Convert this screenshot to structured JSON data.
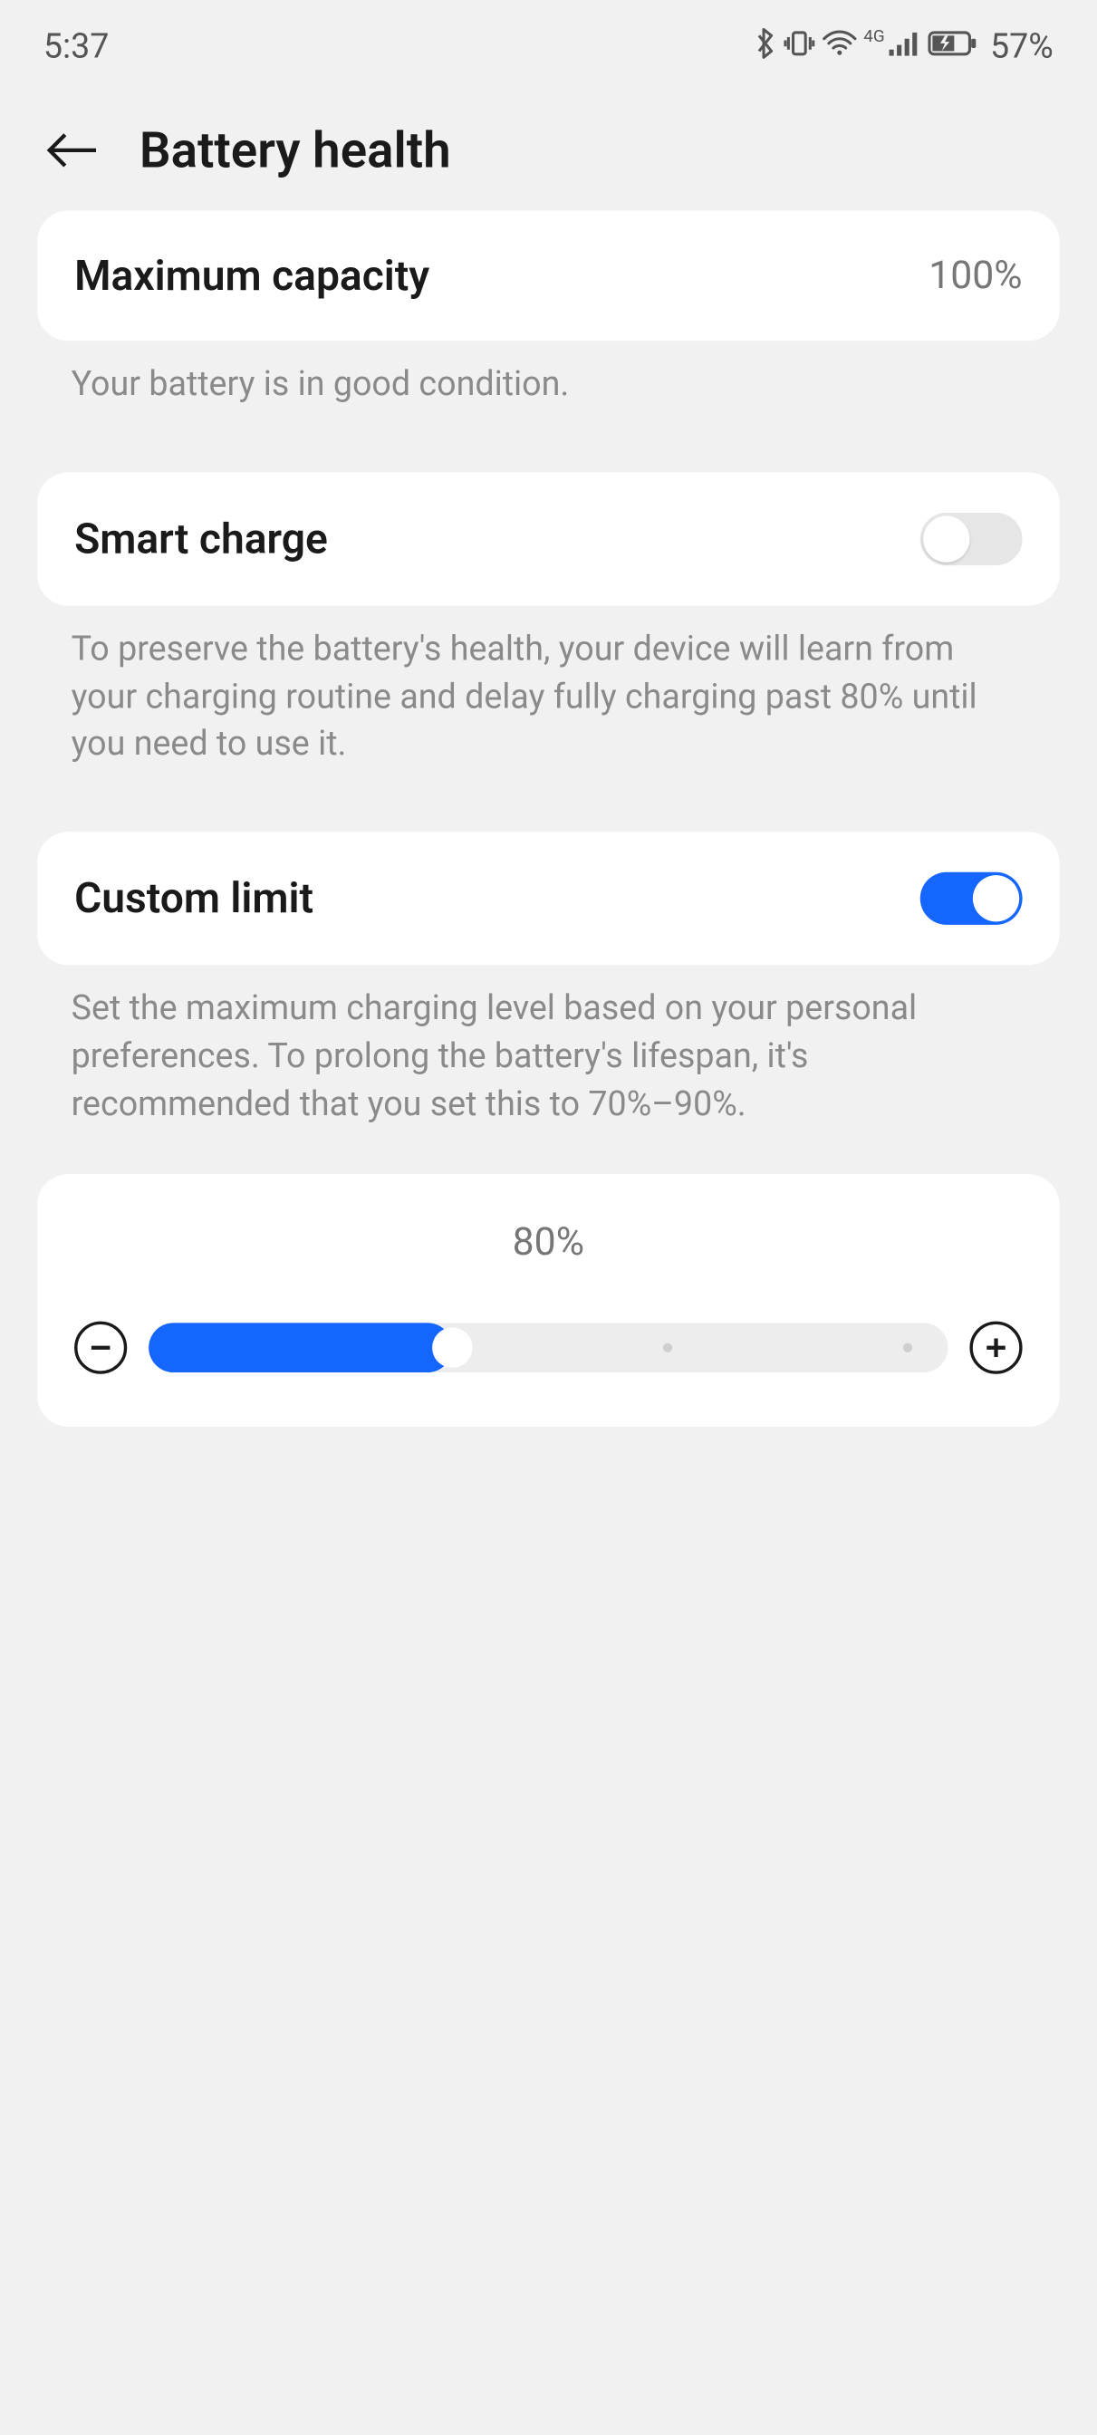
{
  "statusbar": {
    "time": "5:37",
    "network_label": "4G",
    "battery_percent": "57%"
  },
  "header": {
    "title": "Battery health"
  },
  "capacity": {
    "label": "Maximum capacity",
    "value": "100%",
    "desc": "Your battery is in good condition."
  },
  "smart_charge": {
    "label": "Smart charge",
    "enabled": false,
    "desc": "To preserve the battery's health, your device will learn from your charging routine and delay fully charging past 80% until you need to use it."
  },
  "custom_limit": {
    "label": "Custom limit",
    "enabled": true,
    "desc": "Set the maximum charging level based on your personal preferences. To prolong the battery's lifespan, it's recommended that you set this to 70%–90%."
  },
  "slider": {
    "current_label": "80%",
    "value": 80,
    "min": 60,
    "max": 100,
    "fill_percent": 38
  }
}
